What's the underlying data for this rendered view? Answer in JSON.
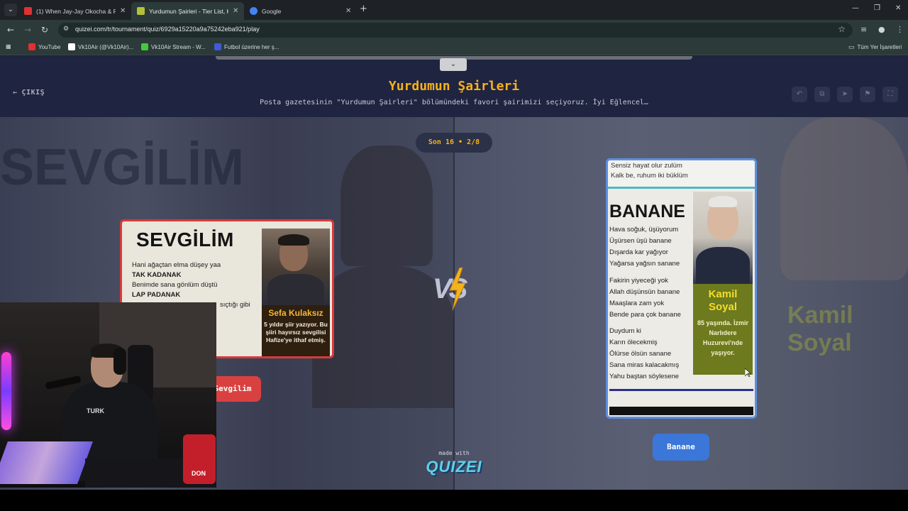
{
  "browser": {
    "tabs": [
      {
        "title": "(1) When Jay-Jay Okocha & Ro",
        "favicon_color": "#e03131",
        "active": false
      },
      {
        "title": "Yurdumun Şairleri - Tier List, Kı",
        "favicon_color": "#b4c038",
        "active": true
      },
      {
        "title": "Google",
        "favicon_color": "#4285f4",
        "active": false
      }
    ],
    "url": "quizei.com/tr/tournament/quiz/6929a15220a9a75242eba921/play",
    "bookmarks": [
      {
        "label": "YouTube",
        "color": "#e03131"
      },
      {
        "label": "Vk10Air (@Vk10Air)...",
        "color": "#ffffff"
      },
      {
        "label": "Vk10Air Stream - W...",
        "color": "#45c93a"
      },
      {
        "label": "Futbol üzerine her ş...",
        "color": "#3f5bd6"
      }
    ],
    "all_bookmarks": "Tüm Yer İşaretleri"
  },
  "header": {
    "exit_label": "ÇIKIŞ",
    "title": "Yurdumun Şairleri",
    "subtitle": "Posta gazetesinin \"Yurdumun Şairleri\" bölümündeki favori şairimizi seçiyoruz. İyi Eğlencel…",
    "icons": [
      "undo-icon",
      "share-link-icon",
      "send-icon",
      "flag-icon",
      "fullscreen-icon"
    ]
  },
  "round": {
    "label": "Son 16 • 2/8"
  },
  "left": {
    "button_label": "Sevgilim",
    "bg_text": "SEVGİLİM",
    "card": {
      "title": "SEVGİLİM",
      "lines": [
        {
          "text": "Hani ağaçtan elma düşey yaa",
          "bold": false
        },
        {
          "text": "TAK KADANAK",
          "bold": true
        },
        {
          "text": "Benimde sana gönlüm düştü",
          "bold": false
        },
        {
          "text": "LAP PADANAK",
          "bold": true
        },
        {
          "text": "sıçtığı gibi",
          "bold": false
        }
      ],
      "name": "Sefa Kulaksız",
      "desc": "5 yıldır şiir yazıyor. Bu şiiri hayırsız sevgilisi Hafize'ye ithaf etmiş."
    }
  },
  "right": {
    "button_label": "Banane",
    "bg_text": "Kamil Soyal",
    "card": {
      "top_lines": [
        "Sensiz hayat olur zulüm",
        "Kalk be, ruhum iki büklüm"
      ],
      "title": "BANANE",
      "lines": [
        "Hava soğuk, üşüyorum",
        "Üşürsen üşü banane",
        "Dışarda kar yağıyor",
        "Yağarsa yağsın sanane",
        "",
        "Fakirin yiyeceği yok",
        "Allah düşünsün banane",
        "Maaşlara zam yok",
        "Bende para çok banane",
        "",
        "Duydum ki",
        "Karın ölecekmiş",
        "Ölürse ölsün sanane",
        "Sana miras kalacakmış",
        "Yahu baştan söylesene"
      ],
      "name": "Kamil Soyal",
      "desc": "85 yaşında. İzmir Narlıdere Huzurevi'nde yaşıyor."
    }
  },
  "vs_label": "VS",
  "footer": {
    "made_with": "made with",
    "logo": "QUIZEI"
  },
  "webcam": {
    "shirt_text": "TURK",
    "cup_text": "DON"
  },
  "colors": {
    "accent_gold": "#f6b21a",
    "left_red": "#d94141",
    "right_blue": "#3b77d8",
    "header_bg": "#1f2440"
  }
}
